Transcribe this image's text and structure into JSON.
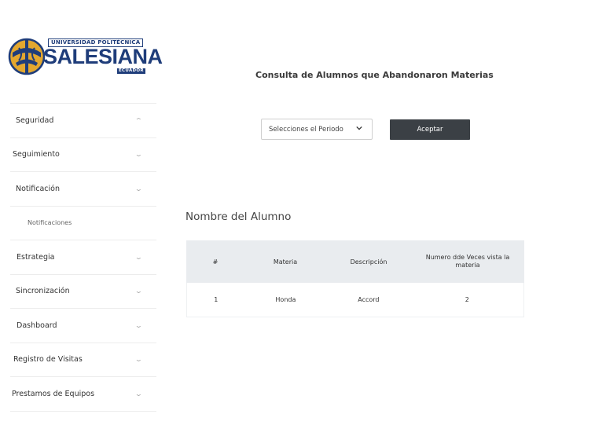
{
  "logo": {
    "university_line": "UNIVERSIDAD POLITÉCNICA",
    "name": "SALESIANA",
    "country": "ECUADOR"
  },
  "sidebar": {
    "items": [
      {
        "label": "Seguridad",
        "chevron": "chevron-up"
      },
      {
        "label": "Seguimiento",
        "chevron": "chevron-down"
      },
      {
        "label": "Notificación",
        "chevron": "chevron-down"
      },
      {
        "label": "Notificaciones",
        "chevron": ""
      },
      {
        "label": "Estrategia",
        "chevron": "chevron-down"
      },
      {
        "label": "Sincronización",
        "chevron": "chevron-down"
      },
      {
        "label": "Dashboard",
        "chevron": "chevron-down"
      },
      {
        "label": "Registro de Visitas",
        "chevron": "chevron-down"
      },
      {
        "label": "Prestamos de Equipos",
        "chevron": "chevron-down"
      }
    ]
  },
  "main": {
    "title": "Consulta de Alumnos que Abandonaron Materias",
    "period_select": {
      "selected": "Selecciones el Periodo"
    },
    "accept_label": "Aceptar",
    "section_title": "Nombre del Alumno",
    "table": {
      "headers": [
        "#",
        "Materia",
        "Descripción",
        "Numero dde Veces vista la materia"
      ],
      "rows": [
        [
          "1",
          "Honda",
          "Accord",
          "2"
        ]
      ]
    }
  },
  "colors": {
    "brand_blue": "#1f3d7a",
    "logo_gold": "#e3a72f",
    "button_dark": "#3b4045",
    "table_header_bg": "#e9ecef"
  }
}
